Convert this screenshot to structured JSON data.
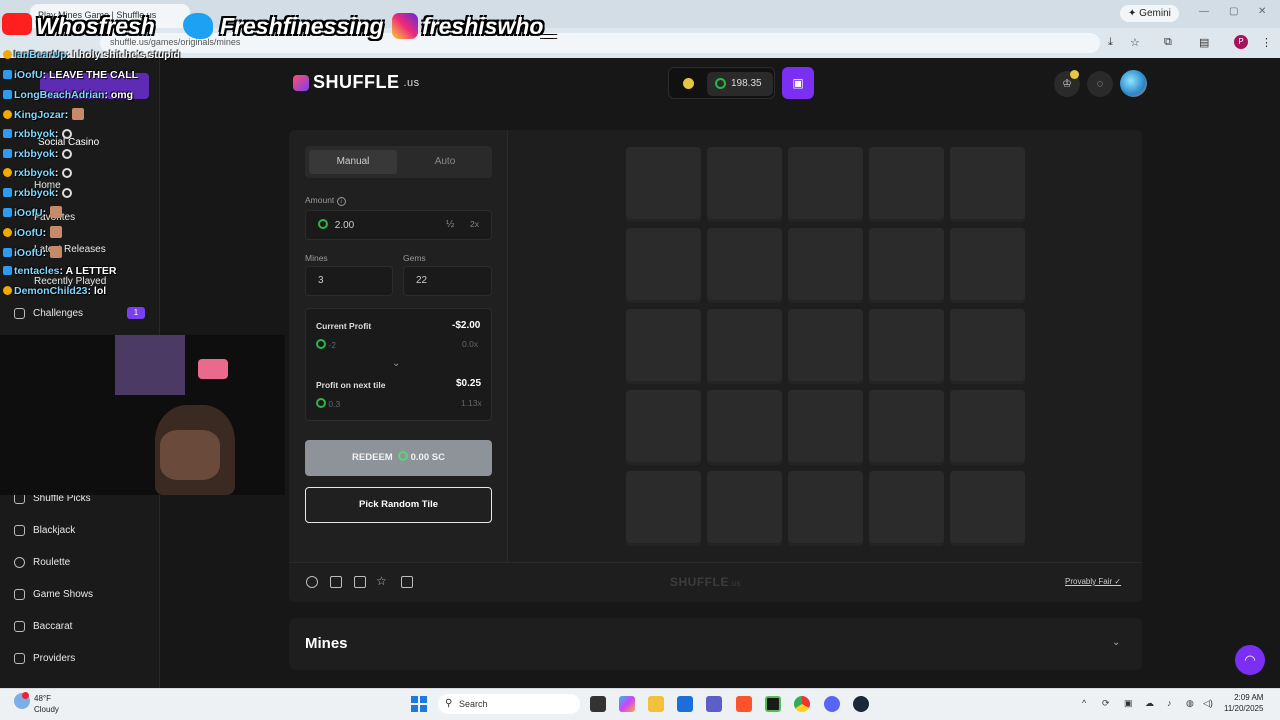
{
  "browser": {
    "tab_title": "Play Mines Game | Shuffle.us",
    "address": "shuffle.us/games/originals/mines",
    "gemini_label": "Gemini",
    "profile_initial": "P"
  },
  "overlay": {
    "socials": [
      "Whosfresh",
      "Freshfinessing",
      "freshiswho_"
    ],
    "chat": [
      {
        "user": "IanBearUp",
        "msg": ": I holy shit he's stupid"
      },
      {
        "user": "iOofU",
        "msg": ": LEAVE THE CALL"
      },
      {
        "user": "LongBeachAdrian",
        "msg": ": omg"
      },
      {
        "user": "KingJozar",
        "msg": ":"
      },
      {
        "user": "rxbbyok",
        "msg": ":"
      },
      {
        "user": "rxbbyok",
        "msg": ":"
      },
      {
        "user": "rxbbyok",
        "msg": ":"
      },
      {
        "user": "rxbbyok",
        "msg": ":"
      },
      {
        "user": "iOofU",
        "msg": ":"
      },
      {
        "user": "iOofU",
        "msg": ":"
      },
      {
        "user": "iOofU",
        "msg": ":"
      },
      {
        "user": "tentacles",
        "msg": ": A LETTER"
      },
      {
        "user": "DemonChild23",
        "msg": ": lol"
      }
    ]
  },
  "sidebar": {
    "hidden_items": [
      "Social Casino",
      "Home",
      "Favorites",
      "Latest Releases",
      "Recently Played"
    ],
    "challenges": {
      "label": "Challenges",
      "badge": "1"
    },
    "items": [
      "Shuffle Picks",
      "Blackjack",
      "Roulette",
      "Game Shows",
      "Baccarat",
      "Providers"
    ]
  },
  "header": {
    "logo": "SHUFFLE",
    "logo_suffix": ".us",
    "balance": "198.35"
  },
  "controls": {
    "tabs": [
      "Manual",
      "Auto"
    ],
    "amount_label": "Amount",
    "amount_value": "2.00",
    "half": "½",
    "double": "2x",
    "mines_label": "Mines",
    "mines_value": "3",
    "gems_label": "Gems",
    "gems_value": "22",
    "current_profit_label": "Current Profit",
    "current_profit_value": "-$2.00",
    "current_profit_sc": "-2",
    "current_multiplier": "0.0x",
    "next_tile_label": "Profit on next tile",
    "next_tile_value": "$0.25",
    "next_tile_sc": "0.3",
    "next_multiplier": "1.13x",
    "redeem_label": "REDEEM",
    "redeem_amount": "0.00 SC",
    "random_label": "Pick Random Tile"
  },
  "grid": {
    "rows": 5,
    "cols": 5
  },
  "footer": {
    "logo": "SHUFFLE",
    "logo_suffix": ".us",
    "provably_fair": "Provably Fair"
  },
  "section": {
    "title": "Mines"
  },
  "taskbar": {
    "temp": "48°F",
    "weather": "Cloudy",
    "search": "Search",
    "time": "2:09 AM",
    "date": "11/20/2025"
  },
  "colors": {
    "accent": "#7b2ff2",
    "gem": "#2fb34a",
    "coin": "#e8c542"
  }
}
